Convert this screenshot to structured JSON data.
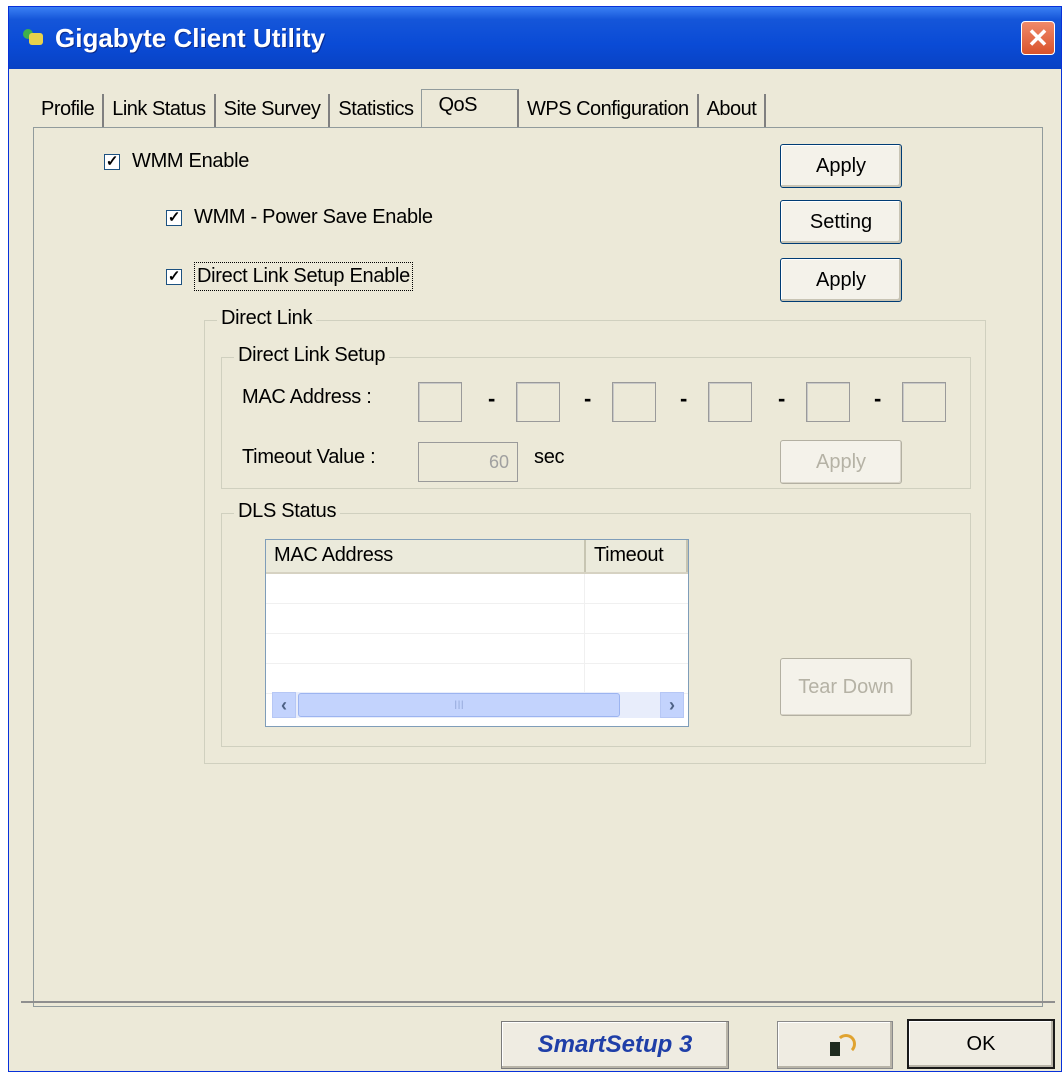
{
  "window": {
    "title": "Gigabyte Client Utility"
  },
  "tabs": [
    {
      "label": "Profile"
    },
    {
      "label": "Link Status"
    },
    {
      "label": "Site Survey"
    },
    {
      "label": "Statistics"
    },
    {
      "label": "QoS",
      "active": true
    },
    {
      "label": "WPS Configuration"
    },
    {
      "label": "About"
    }
  ],
  "qos": {
    "wmm_enable": {
      "label": "WMM Enable",
      "checked": true
    },
    "wmm_power_save": {
      "label": "WMM - Power Save Enable",
      "checked": true
    },
    "dls_enable": {
      "label": "Direct Link Setup Enable",
      "checked": true
    },
    "apply_label": "Apply",
    "setting_label": "Setting",
    "apply2_label": "Apply"
  },
  "direct_link": {
    "group_label": "Direct Link",
    "setup": {
      "group_label": "Direct Link Setup",
      "mac_label": "MAC Address :",
      "mac_separator": "-",
      "timeout_label": "Timeout Value :",
      "timeout_value": "60",
      "timeout_unit": "sec",
      "apply_label": "Apply"
    },
    "status": {
      "group_label": "DLS Status",
      "columns": [
        "MAC Address",
        "Timeout"
      ],
      "scroll_thumb": "III",
      "teardown_label": "Tear Down"
    }
  },
  "footer": {
    "smartsetup_label": "SmartSetup 3",
    "ok_label": "OK"
  },
  "colors": {
    "titlebar": "#0a4bd6",
    "window_bg": "#ece9d8",
    "close": "#d9532b",
    "smartsetup_text": "#1f3fa8"
  },
  "icons": {
    "app": "app-icon",
    "close": "close-icon",
    "footer_network": "wireless-network-icon"
  }
}
